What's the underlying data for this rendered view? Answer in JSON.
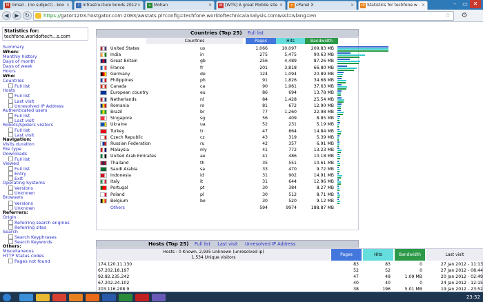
{
  "browser": {
    "tabs": [
      {
        "label": "Gmail - (no subject) - koo",
        "color": "#c23321",
        "icon": "M"
      },
      {
        "label": "Infrastructure bonds 2012",
        "color": "#3a6bb5",
        "icon": "I"
      },
      {
        "label": "Mohan",
        "color": "#2a8a3a",
        "icon": "+"
      },
      {
        "label": "[WTS] A great Mobile site",
        "color": "#c33",
        "icon": "W"
      },
      {
        "label": "cPanel X",
        "color": "#e8841a",
        "icon": "c"
      },
      {
        "label": "Statistics for techfone.w",
        "color": "#e8841a",
        "icon": "cP"
      }
    ],
    "url_secure": "https://",
    "url_rest": "gator1203.hostgator.com:2083/awstats.pl?config=techfone.worldoftechnicalanalysis.com&ssl=&lang=en"
  },
  "sidebar": {
    "stats_label": "Statistics for:",
    "stats_domain": "techfone.worldoftech...s.com",
    "items": [
      {
        "t": "Summary",
        "k": "link"
      },
      {
        "t": "When:",
        "k": "hd"
      },
      {
        "t": "Monthly history",
        "k": "link"
      },
      {
        "t": "Days of month",
        "k": "link"
      },
      {
        "t": "Days of week",
        "k": "link"
      },
      {
        "t": "Hours",
        "k": "link"
      },
      {
        "t": "Who:",
        "k": "hd"
      },
      {
        "t": "Countries",
        "k": "link"
      },
      {
        "t": "Full list",
        "k": "sub"
      },
      {
        "t": "Hosts",
        "k": "link"
      },
      {
        "t": "Full list",
        "k": "sub"
      },
      {
        "t": "Last visit",
        "k": "sub"
      },
      {
        "t": "Unresolved IP Address",
        "k": "sub"
      },
      {
        "t": "Authenticated users",
        "k": "link"
      },
      {
        "t": "Full list",
        "k": "sub"
      },
      {
        "t": "Last visit",
        "k": "sub"
      },
      {
        "t": "Robots/Spiders visitors",
        "k": "link"
      },
      {
        "t": "Full list",
        "k": "sub"
      },
      {
        "t": "Last visit",
        "k": "sub"
      },
      {
        "t": "Navigation:",
        "k": "hd"
      },
      {
        "t": "Visits duration",
        "k": "link"
      },
      {
        "t": "File type",
        "k": "link"
      },
      {
        "t": "Downloads",
        "k": "link"
      },
      {
        "t": "Full list",
        "k": "sub"
      },
      {
        "t": "Viewed",
        "k": "link"
      },
      {
        "t": "Full list",
        "k": "sub"
      },
      {
        "t": "Entry",
        "k": "sub"
      },
      {
        "t": "Exit",
        "k": "sub"
      },
      {
        "t": "Operating Systems",
        "k": "link"
      },
      {
        "t": "Versions",
        "k": "sub"
      },
      {
        "t": "Unknown",
        "k": "sub"
      },
      {
        "t": "Browsers",
        "k": "link"
      },
      {
        "t": "Versions",
        "k": "sub"
      },
      {
        "t": "Unknown",
        "k": "sub"
      },
      {
        "t": "Referrers:",
        "k": "hd"
      },
      {
        "t": "Origin",
        "k": "link"
      },
      {
        "t": "Referring search engines",
        "k": "sub"
      },
      {
        "t": "Referring sites",
        "k": "sub"
      },
      {
        "t": "Search",
        "k": "link"
      },
      {
        "t": "Search Keyphrases",
        "k": "sub"
      },
      {
        "t": "Search Keywords",
        "k": "sub"
      },
      {
        "t": "Others:",
        "k": "hd"
      },
      {
        "t": "Miscellaneous",
        "k": "link"
      },
      {
        "t": "HTTP Status codes",
        "k": "link"
      },
      {
        "t": "Pages not found",
        "k": "sub"
      }
    ]
  },
  "countries": {
    "title": "Countries (Top 25)",
    "full_list": "Full list",
    "headers": {
      "countries": "Countries",
      "pages": "Pages",
      "hits": "Hits",
      "bandwidth": "Bandwidth"
    },
    "header_colors": {
      "pages": "#4477dd",
      "hits": "#66dddd",
      "bandwidth": "#2c9a48"
    },
    "rows": [
      {
        "name": "United States",
        "code": "us",
        "pages": "1,066",
        "hits": "10,097",
        "bw": "209.83 MB",
        "p": 1066,
        "h": 10097,
        "b": 209.83,
        "flag": [
          "#b22234",
          "#fff",
          "#3c3b6e"
        ]
      },
      {
        "name": "India",
        "code": "in",
        "pages": "275",
        "hits": "5,475",
        "bw": "90.63 MB",
        "p": 275,
        "h": 5475,
        "b": 90.63,
        "flag": [
          "#ff9933",
          "#fff",
          "#138808"
        ]
      },
      {
        "name": "Great Britain",
        "code": "gb",
        "pages": "256",
        "hits": "4,489",
        "bw": "87.26 MB",
        "p": 256,
        "h": 4489,
        "b": 87.26,
        "flag": [
          "#012169",
          "#c8102e",
          "#012169"
        ]
      },
      {
        "name": "France",
        "code": "fr",
        "pages": "201",
        "hits": "3,818",
        "bw": "66.80 MB",
        "p": 201,
        "h": 3818,
        "b": 66.8,
        "flag": [
          "#0055a4",
          "#fff",
          "#ef4135"
        ]
      },
      {
        "name": "Germany",
        "code": "de",
        "pages": "124",
        "hits": "1,094",
        "bw": "20.89 MB",
        "p": 124,
        "h": 1094,
        "b": 20.89,
        "flag": [
          "#000",
          "#dd0000",
          "#ffce00"
        ]
      },
      {
        "name": "Philippines",
        "code": "ph",
        "pages": "91",
        "hits": "1,826",
        "bw": "34.68 MB",
        "p": 91,
        "h": 1826,
        "b": 34.68,
        "flag": [
          "#0038a8",
          "#fff",
          "#ce1126"
        ]
      },
      {
        "name": "Canada",
        "code": "ca",
        "pages": "90",
        "hits": "1,961",
        "bw": "37.63 MB",
        "p": 90,
        "h": 1961,
        "b": 37.63,
        "flag": [
          "#d52b1e",
          "#fff",
          "#d52b1e"
        ]
      },
      {
        "name": "European country",
        "code": "eu",
        "pages": "86",
        "hits": "694",
        "bw": "13.78 MB",
        "p": 86,
        "h": 694,
        "b": 13.78,
        "flag": [
          "#003399",
          "#003399",
          "#003399"
        ]
      },
      {
        "name": "Netherlands",
        "code": "nl",
        "pages": "84",
        "hits": "1,428",
        "bw": "25.54 MB",
        "p": 84,
        "h": 1428,
        "b": 25.54,
        "flag": [
          "#ae1c28",
          "#fff",
          "#21468b"
        ]
      },
      {
        "name": "Romania",
        "code": "ro",
        "pages": "81",
        "hits": "672",
        "bw": "12.90 MB",
        "p": 81,
        "h": 672,
        "b": 12.9,
        "flag": [
          "#002b7f",
          "#fcd116",
          "#ce1126"
        ]
      },
      {
        "name": "Brazil",
        "code": "br",
        "pages": "77",
        "hits": "1,260",
        "bw": "22.98 MB",
        "p": 77,
        "h": 1260,
        "b": 22.98,
        "flag": [
          "#009c3b",
          "#ffdf00",
          "#009c3b"
        ]
      },
      {
        "name": "Singapore",
        "code": "sg",
        "pages": "56",
        "hits": "409",
        "bw": "8.85 MB",
        "p": 56,
        "h": 409,
        "b": 8.85,
        "flag": [
          "#ef3340",
          "#ef3340",
          "#fff"
        ]
      },
      {
        "name": "Ukraine",
        "code": "ua",
        "pages": "52",
        "hits": "231",
        "bw": "5.19 MB",
        "p": 52,
        "h": 231,
        "b": 5.19,
        "flag": [
          "#0057b7",
          "#0057b7",
          "#ffd700"
        ]
      },
      {
        "name": "Turkey",
        "code": "tr",
        "pages": "47",
        "hits": "864",
        "bw": "14.84 MB",
        "p": 47,
        "h": 864,
        "b": 14.84,
        "flag": [
          "#e30a17",
          "#e30a17",
          "#e30a17"
        ]
      },
      {
        "name": "Czech Republic",
        "code": "cz",
        "pages": "43",
        "hits": "319",
        "bw": "5.39 MB",
        "p": 43,
        "h": 319,
        "b": 5.39,
        "flag": [
          "#fff",
          "#fff",
          "#d7141a"
        ]
      },
      {
        "name": "Russian Federation",
        "code": "ru",
        "pages": "42",
        "hits": "357",
        "bw": "6.91 MB",
        "p": 42,
        "h": 357,
        "b": 6.91,
        "flag": [
          "#fff",
          "#0039a6",
          "#d52b1e"
        ]
      },
      {
        "name": "Malaysia",
        "code": "my",
        "pages": "41",
        "hits": "772",
        "bw": "13.23 MB",
        "p": 41,
        "h": 772,
        "b": 13.23,
        "flag": [
          "#cc0001",
          "#fff",
          "#010066"
        ]
      },
      {
        "name": "United Arab Emirates",
        "code": "ae",
        "pages": "41",
        "hits": "486",
        "bw": "10.18 MB",
        "p": 41,
        "h": 486,
        "b": 10.18,
        "flag": [
          "#00732f",
          "#fff",
          "#000"
        ]
      },
      {
        "name": "Thailand",
        "code": "th",
        "pages": "35",
        "hits": "551",
        "bw": "10.61 MB",
        "p": 35,
        "h": 551,
        "b": 10.61,
        "flag": [
          "#a51931",
          "#2d2a4a",
          "#a51931"
        ]
      },
      {
        "name": "Saudi Arabia",
        "code": "sa",
        "pages": "33",
        "hits": "470",
        "bw": "9.72 MB",
        "p": 33,
        "h": 470,
        "b": 9.72,
        "flag": [
          "#006c35",
          "#006c35",
          "#006c35"
        ]
      },
      {
        "name": "Indonesia",
        "code": "id",
        "pages": "31",
        "hits": "902",
        "bw": "14.91 MB",
        "p": 31,
        "h": 902,
        "b": 14.91,
        "flag": [
          "#ce1126",
          "#ce1126",
          "#fff"
        ]
      },
      {
        "name": "Italy",
        "code": "it",
        "pages": "31",
        "hits": "644",
        "bw": "12.96 MB",
        "p": 31,
        "h": 644,
        "b": 12.96,
        "flag": [
          "#009246",
          "#fff",
          "#ce2b37"
        ]
      },
      {
        "name": "Portugal",
        "code": "pt",
        "pages": "30",
        "hits": "384",
        "bw": "8.27 MB",
        "p": 30,
        "h": 384,
        "b": 8.27,
        "flag": [
          "#006600",
          "#ff0000",
          "#ff0000"
        ]
      },
      {
        "name": "Poland",
        "code": "pl",
        "pages": "30",
        "hits": "512",
        "bw": "8.71 MB",
        "p": 30,
        "h": 512,
        "b": 8.71,
        "flag": [
          "#fff",
          "#fff",
          "#dc143c"
        ]
      },
      {
        "name": "Belgium",
        "code": "be",
        "pages": "30",
        "hits": "520",
        "bw": "9.12 MB",
        "p": 30,
        "h": 520,
        "b": 9.12,
        "flag": [
          "#000",
          "#fdda24",
          "#ef3340"
        ]
      }
    ],
    "others": {
      "name": "Others",
      "pages": "594",
      "hits": "9974",
      "bw": "188.87 MB"
    }
  },
  "hosts": {
    "title": "Hosts (Top 25)",
    "links": [
      "Full list",
      "Last visit",
      "Unresolved IP Address"
    ],
    "summary_line1": "Hosts : 0 Known, 2,935 Unknown (unresolved ip)",
    "summary_line2": "1,534 Unique visitors",
    "headers": {
      "pages": "Pages",
      "hits": "Hits",
      "bandwidth": "Bandwidth",
      "last_visit": "Last visit"
    },
    "rows": [
      {
        "host": "174.120.11.130",
        "pages": "83",
        "hits": "83",
        "bw": "0",
        "last": "27 Jan 2012 - 11:13"
      },
      {
        "host": "67.202.18.197",
        "pages": "52",
        "hits": "52",
        "bw": "0",
        "last": "27 Jan 2012 - 08:44"
      },
      {
        "host": "92.82.235.242",
        "pages": "47",
        "hits": "49",
        "bw": "1.09 MB",
        "last": "20 Jan 2012 - 02:49"
      },
      {
        "host": "67.202.24.102",
        "pages": "40",
        "hits": "40",
        "bw": "0",
        "last": "24 Jan 2012 - 12:15"
      },
      {
        "host": "203.116.208.9",
        "pages": "38",
        "hits": "196",
        "bw": "5.01 MB",
        "last": "19 Jan 2012 - 23:52"
      }
    ]
  },
  "taskbar": {
    "items": [
      {
        "icon": "start-orb",
        "color": "#2f7fd0"
      },
      {
        "icon": "ie-icon",
        "color": "#3a8fd8"
      },
      {
        "icon": "folder-icon",
        "color": "#e8b830"
      },
      {
        "icon": "chrome-icon",
        "color": "#d84030"
      },
      {
        "icon": "media-icon",
        "color": "#e88020"
      },
      {
        "icon": "firefox-icon",
        "color": "#e86a1a"
      },
      {
        "icon": "word-icon",
        "color": "#2a5aa8"
      },
      {
        "icon": "excel-icon",
        "color": "#2a8a3a"
      },
      {
        "icon": "pdf-icon",
        "color": "#c02020"
      },
      {
        "icon": "app-icon",
        "color": "#6a5ab8"
      }
    ],
    "clock": "23:52"
  }
}
